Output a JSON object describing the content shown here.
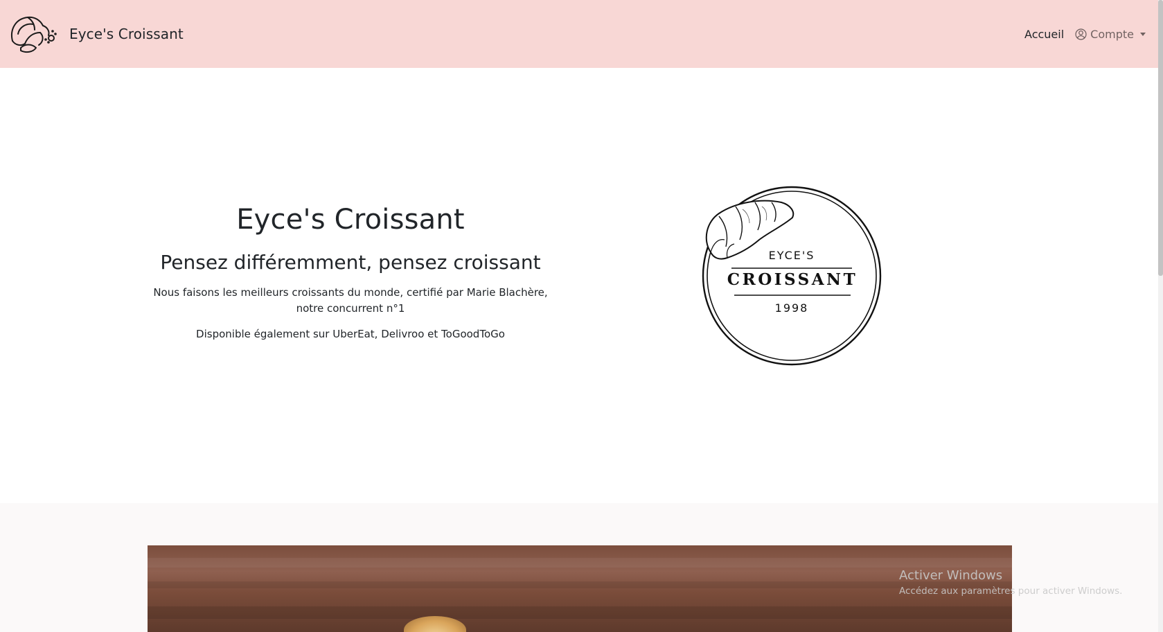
{
  "navbar": {
    "brand_name": "Eyce's Croissant",
    "home_link": "Accueil",
    "account_label": "Compte",
    "background_color": "#f8d7d5"
  },
  "hero": {
    "title": "Eyce's Croissant",
    "subtitle": "Pensez différemment, pensez croissant",
    "description": "Nous faisons les meilleurs croissants du monde, certifié par Marie Blachère, notre concurrent n°1",
    "availability": "Disponible également sur UberEat, Delivroo et ToGoodToGo"
  },
  "badge": {
    "top_text": "EYCE'S",
    "main_text": "CROISSANT",
    "year": "1998"
  },
  "watermark": {
    "title": "Activer Windows",
    "subtitle": "Accédez aux paramètres pour activer Windows."
  },
  "icons": {
    "brand": "croissant-logo-icon",
    "account": "user-circle-icon",
    "dropdown": "caret-down-icon"
  }
}
